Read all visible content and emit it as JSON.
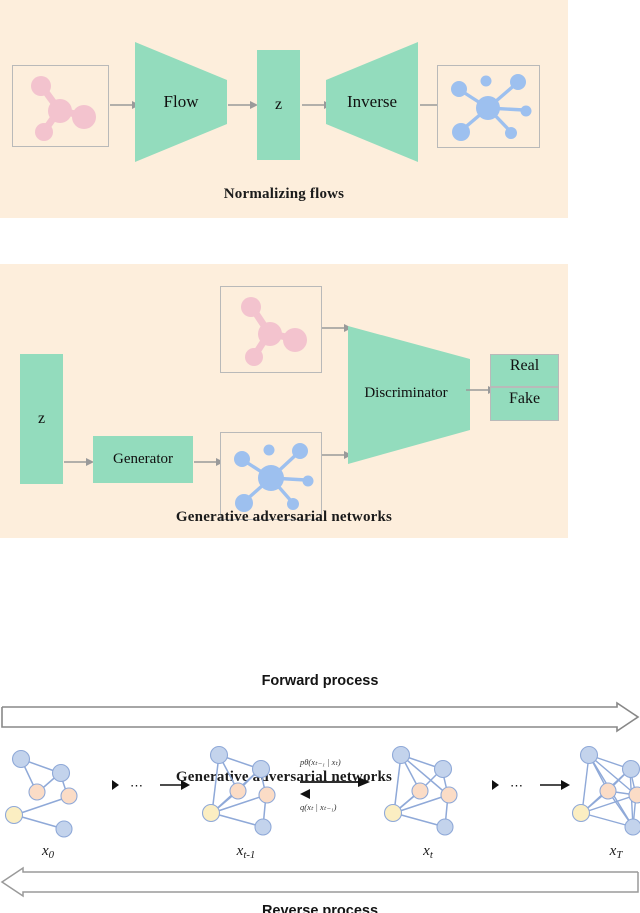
{
  "figure": {
    "kind": "diagram",
    "title_absent": true
  },
  "colors": {
    "panel_background": "#fdeedc",
    "page_background": "#ffffff",
    "teal_block": "#93dcbd",
    "box_border": "#b9b9b9",
    "molecule_pink": "#f3c3ce",
    "network_blue": "#9dc0ef",
    "graph_node_blue": "#c3d3ec",
    "graph_node_peach": "#fbdcc6",
    "graph_node_yellow": "#fbeec2",
    "graph_edge": "#8fa9d8",
    "arrow_gray": "#9a9a9a",
    "arrow_black": "#111111",
    "text_dark": "#101010"
  },
  "panel_flows": {
    "caption": "Normalizing flows",
    "input_box": {
      "name": "pink molecule input",
      "icon": "molecule-icon"
    },
    "encoder": {
      "label": "Flow",
      "shape": "trapezoid-right-narrow"
    },
    "latent": {
      "label": "z",
      "shape": "rectangle"
    },
    "decoder": {
      "label": "Inverse",
      "shape": "trapezoid-right-wide"
    },
    "output_box": {
      "name": "blue network output",
      "icon": "network-icon"
    },
    "arrows": 4
  },
  "panel_gan": {
    "caption": "Generative adversarial networks",
    "latent": {
      "label": "z",
      "shape": "rectangle"
    },
    "generator": {
      "label": "Generator",
      "shape": "rectangle"
    },
    "real_box": {
      "name": "real pink molecule sample",
      "icon": "molecule-icon"
    },
    "fake_box": {
      "name": "generated blue network sample",
      "icon": "network-icon"
    },
    "discriminator": {
      "label": "Discriminator",
      "shape": "trapezoid-right-narrow"
    },
    "verdict": {
      "top_label": "Real",
      "bottom_label": "Fake"
    },
    "arrows": 5
  },
  "panel_diffusion": {
    "forward_title": "Forward process",
    "reverse_title": "Reverse process",
    "reverse_title_clipped": true,
    "forward_arrow_direction": "right",
    "reverse_arrow_direction": "left",
    "transition_labels": {
      "reverse_model": "pθ(xₜ₋₁ | xₜ)",
      "forward_kernel": "q(xₜ | xₜ₋₁)"
    },
    "steps": [
      {
        "label_base": "x",
        "label_sub": "0",
        "edges": 5,
        "name": "graph-x0"
      },
      {
        "label_base": "x",
        "label_sub": "t-1",
        "edges": 9,
        "name": "graph-xt-1"
      },
      {
        "label_base": "x",
        "label_sub": "t",
        "edges": 11,
        "name": "graph-xt"
      },
      {
        "label_base": "x",
        "label_sub": "T",
        "edges": 15,
        "name": "graph-xT"
      }
    ],
    "ellipsis": "⋯",
    "ellipsis_count": 2,
    "node_count_per_graph": 6
  }
}
